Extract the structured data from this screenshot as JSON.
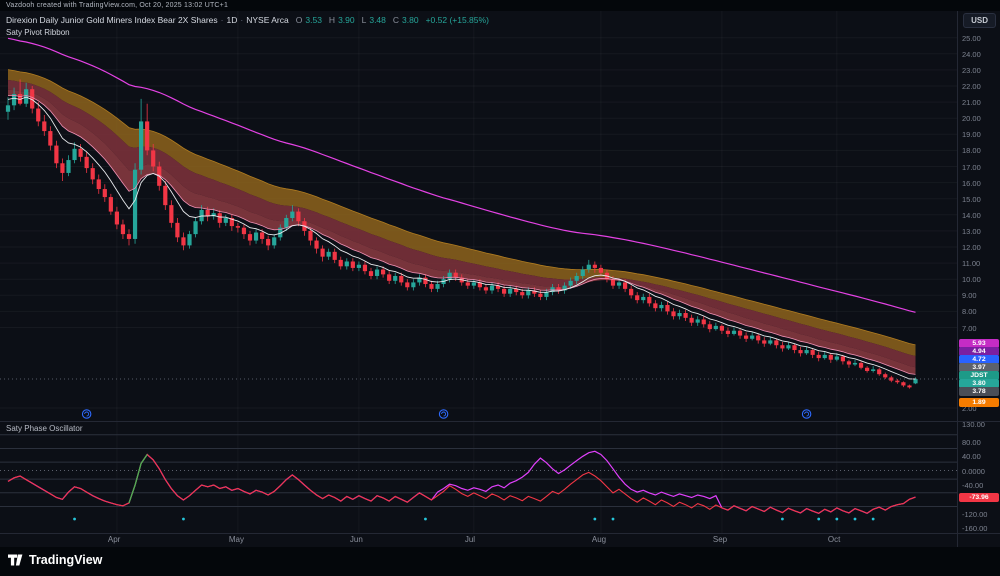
{
  "topbar": {
    "watermark": "Vazdooh created with TradingView.com, Oct 20, 2025 13:02 UTC+1"
  },
  "header": {
    "title": "Direxion Daily Junior Gold Miners Index Bear 2X Shares",
    "separator": "·",
    "timeframe": "1D",
    "exchange": "NYSE Arca",
    "ohlc": {
      "o_label": "O",
      "o": "3.53",
      "h_label": "H",
      "h": "3.90",
      "l_label": "L",
      "l": "3.48",
      "c_label": "C",
      "c": "3.80",
      "change": "+0.52 (+15.85%)"
    },
    "indicator": "Saty Pivot Ribbon"
  },
  "currency_button": {
    "label": "USD"
  },
  "branding": {
    "name": "TradingView"
  },
  "colors": {
    "up": "#26a69a",
    "down": "#f23645",
    "ribbon_fast": "#e8eaed",
    "ribbon_pivot": "#f191b5",
    "ribbon_fill_top": "#8a611c",
    "ribbon_fill_mid": "#77303a",
    "ribbon_fill_low": "#8c3b42",
    "ribbon_edge": "#b07c20",
    "slow_ema": "#e442e4",
    "osc_line": "#f23645",
    "osc_signal": "#e040fb",
    "osc_green": "#4caf50",
    "dots": "#26c6da",
    "marker": "#2e6bff"
  },
  "price_axis": {
    "ticks": [
      {
        "label": "25.00",
        "value": 25
      },
      {
        "label": "24.00",
        "value": 24
      },
      {
        "label": "23.00",
        "value": 23
      },
      {
        "label": "22.00",
        "value": 22
      },
      {
        "label": "21.00",
        "value": 21
      },
      {
        "label": "20.00",
        "value": 20
      },
      {
        "label": "19.00",
        "value": 19
      },
      {
        "label": "18.00",
        "value": 18
      },
      {
        "label": "17.00",
        "value": 17
      },
      {
        "label": "16.00",
        "value": 16
      },
      {
        "label": "15.00",
        "value": 15
      },
      {
        "label": "14.00",
        "value": 14
      },
      {
        "label": "13.00",
        "value": 13
      },
      {
        "label": "12.00",
        "value": 12
      },
      {
        "label": "11.00",
        "value": 11
      },
      {
        "label": "10.00",
        "value": 10
      },
      {
        "label": "9.00",
        "value": 9
      },
      {
        "label": "8.00",
        "value": 8
      },
      {
        "label": "7.00",
        "value": 7
      },
      {
        "label": "2.00",
        "value": 2
      }
    ],
    "chips": [
      {
        "label": "5.93",
        "color": "#c52cc5"
      },
      {
        "label": "4.94",
        "color": "#7b1fa2"
      },
      {
        "label": "4.72",
        "color": "#2962ff"
      },
      {
        "label": "3.97",
        "color": "#5d616b"
      },
      {
        "label": "JDST",
        "color": "#1d9a88"
      },
      {
        "label": "3.80",
        "color": "#26a69a"
      },
      {
        "label": "3.78",
        "color": "#4a4e57"
      },
      {
        "label": "1.89",
        "color": "#f57c00"
      }
    ]
  },
  "chart_data": {
    "type": "candlestick",
    "symbol": "JDST",
    "interval": "1D",
    "title": "Direxion Daily Junior Gold Miners Index Bear 2X Shares",
    "ylim": [
      2,
      26.5
    ],
    "price_line": 3.8,
    "event_marker_indices": [
      13,
      72,
      132
    ],
    "months": [
      {
        "label": "Apr",
        "index": 18
      },
      {
        "label": "May",
        "index": 38
      },
      {
        "label": "Jun",
        "index": 58
      },
      {
        "label": "Jul",
        "index": 77
      },
      {
        "label": "Aug",
        "index": 98
      },
      {
        "label": "Sep",
        "index": 118
      },
      {
        "label": "Oct",
        "index": 137
      }
    ],
    "ribbon": {
      "name": "Saty Pivot Ribbon",
      "ema_periods": [
        8,
        13,
        21,
        34,
        48
      ],
      "slow_ema_period": 90
    },
    "candles": [
      [
        20.4,
        21.3,
        19.9,
        20.8
      ],
      [
        20.8,
        21.9,
        20.5,
        21.5
      ],
      [
        21.5,
        22.4,
        20.8,
        20.9
      ],
      [
        20.9,
        22.2,
        20.7,
        21.8
      ],
      [
        21.8,
        22.0,
        20.3,
        20.6
      ],
      [
        20.6,
        21.0,
        19.5,
        19.8
      ],
      [
        19.8,
        20.2,
        18.9,
        19.2
      ],
      [
        19.2,
        19.5,
        18.0,
        18.3
      ],
      [
        18.3,
        18.6,
        16.9,
        17.2
      ],
      [
        17.2,
        17.5,
        16.1,
        16.6
      ],
      [
        16.6,
        17.7,
        16.4,
        17.4
      ],
      [
        17.4,
        18.5,
        17.2,
        18.1
      ],
      [
        18.1,
        18.4,
        17.3,
        17.6
      ],
      [
        17.6,
        17.9,
        16.6,
        16.9
      ],
      [
        16.9,
        17.2,
        15.9,
        16.2
      ],
      [
        16.2,
        16.5,
        15.3,
        15.6
      ],
      [
        15.6,
        15.9,
        14.8,
        15.1
      ],
      [
        15.1,
        15.3,
        14.0,
        14.2
      ],
      [
        14.2,
        14.5,
        13.1,
        13.4
      ],
      [
        13.4,
        13.7,
        12.5,
        12.8
      ],
      [
        12.8,
        13.1,
        12.1,
        12.5
      ],
      [
        12.5,
        17.2,
        12.2,
        16.8
      ],
      [
        16.8,
        21.2,
        16.5,
        19.8
      ],
      [
        19.8,
        20.9,
        17.7,
        18.0
      ],
      [
        18.0,
        18.4,
        16.7,
        17.0
      ],
      [
        17.0,
        17.3,
        15.5,
        15.8
      ],
      [
        15.8,
        16.1,
        14.3,
        14.6
      ],
      [
        14.6,
        14.9,
        13.2,
        13.5
      ],
      [
        13.5,
        13.8,
        12.3,
        12.6
      ],
      [
        12.6,
        12.9,
        11.8,
        12.1
      ],
      [
        12.1,
        13.0,
        11.9,
        12.8
      ],
      [
        12.8,
        13.8,
        12.6,
        13.6
      ],
      [
        13.6,
        14.6,
        13.4,
        14.3
      ],
      [
        14.3,
        14.5,
        13.6,
        13.9
      ],
      [
        13.9,
        14.4,
        13.7,
        14.1
      ],
      [
        14.1,
        14.3,
        13.2,
        13.5
      ],
      [
        13.5,
        14.0,
        13.3,
        13.8
      ],
      [
        13.8,
        14.0,
        13.0,
        13.3
      ],
      [
        13.3,
        13.5,
        12.9,
        13.2
      ],
      [
        13.2,
        13.4,
        12.5,
        12.8
      ],
      [
        12.8,
        13.0,
        12.1,
        12.4
      ],
      [
        12.4,
        13.1,
        12.2,
        12.9
      ],
      [
        12.9,
        13.1,
        12.2,
        12.5
      ],
      [
        12.5,
        12.7,
        11.8,
        12.1
      ],
      [
        12.1,
        12.8,
        11.9,
        12.6
      ],
      [
        12.6,
        13.4,
        12.4,
        13.2
      ],
      [
        13.2,
        14.0,
        13.0,
        13.8
      ],
      [
        13.8,
        14.6,
        13.6,
        14.2
      ],
      [
        14.2,
        14.4,
        13.3,
        13.6
      ],
      [
        13.6,
        13.8,
        12.7,
        13.0
      ],
      [
        13.0,
        13.2,
        12.1,
        12.4
      ],
      [
        12.4,
        12.6,
        11.6,
        11.9
      ],
      [
        11.9,
        12.1,
        11.1,
        11.4
      ],
      [
        11.4,
        11.9,
        11.2,
        11.7
      ],
      [
        11.7,
        11.9,
        11.0,
        11.2
      ],
      [
        11.2,
        11.4,
        10.6,
        10.8
      ],
      [
        10.8,
        11.3,
        10.6,
        11.1
      ],
      [
        11.1,
        11.3,
        10.5,
        10.7
      ],
      [
        10.7,
        11.1,
        10.5,
        10.9
      ],
      [
        10.9,
        11.1,
        10.3,
        10.5
      ],
      [
        10.5,
        10.7,
        10.0,
        10.2
      ],
      [
        10.2,
        10.8,
        10.0,
        10.6
      ],
      [
        10.6,
        10.8,
        10.1,
        10.3
      ],
      [
        10.3,
        10.5,
        9.7,
        9.9
      ],
      [
        9.9,
        10.4,
        9.7,
        10.2
      ],
      [
        10.2,
        10.4,
        9.6,
        9.8
      ],
      [
        9.8,
        10.0,
        9.3,
        9.5
      ],
      [
        9.5,
        10.0,
        9.3,
        9.8
      ],
      [
        9.8,
        10.3,
        9.6,
        10.1
      ],
      [
        10.1,
        10.3,
        9.5,
        9.7
      ],
      [
        9.7,
        9.9,
        9.2,
        9.4
      ],
      [
        9.4,
        9.9,
        9.2,
        9.7
      ],
      [
        9.7,
        10.2,
        9.5,
        10.0
      ],
      [
        10.0,
        10.6,
        9.8,
        10.4
      ],
      [
        10.4,
        10.6,
        9.9,
        10.1
      ],
      [
        10.1,
        10.3,
        9.6,
        9.8
      ],
      [
        9.8,
        10.0,
        9.4,
        9.6
      ],
      [
        9.6,
        10.0,
        9.4,
        9.8
      ],
      [
        9.8,
        10.0,
        9.3,
        9.5
      ],
      [
        9.5,
        9.7,
        9.1,
        9.3
      ],
      [
        9.3,
        9.8,
        9.1,
        9.6
      ],
      [
        9.6,
        9.8,
        9.2,
        9.4
      ],
      [
        9.4,
        9.6,
        8.9,
        9.1
      ],
      [
        9.1,
        9.6,
        8.9,
        9.4
      ],
      [
        9.4,
        9.6,
        9.0,
        9.2
      ],
      [
        9.2,
        9.4,
        8.8,
        9.0
      ],
      [
        9.0,
        9.5,
        8.8,
        9.3
      ],
      [
        9.3,
        9.5,
        8.9,
        9.1
      ],
      [
        9.1,
        9.3,
        8.7,
        8.9
      ],
      [
        8.9,
        9.4,
        8.7,
        9.2
      ],
      [
        9.2,
        9.7,
        9.0,
        9.5
      ],
      [
        9.5,
        9.7,
        9.1,
        9.3
      ],
      [
        9.3,
        9.8,
        9.1,
        9.6
      ],
      [
        9.6,
        10.1,
        9.4,
        9.9
      ],
      [
        9.9,
        10.4,
        9.7,
        10.2
      ],
      [
        10.2,
        10.8,
        10.0,
        10.6
      ],
      [
        10.6,
        11.2,
        10.4,
        10.9
      ],
      [
        10.9,
        11.1,
        10.4,
        10.7
      ],
      [
        10.7,
        10.9,
        10.2,
        10.4
      ],
      [
        10.4,
        10.6,
        9.8,
        10.0
      ],
      [
        10.0,
        10.2,
        9.4,
        9.6
      ],
      [
        9.6,
        10.0,
        9.4,
        9.8
      ],
      [
        9.8,
        10.0,
        9.2,
        9.4
      ],
      [
        9.4,
        9.6,
        8.8,
        9.0
      ],
      [
        9.0,
        9.2,
        8.5,
        8.7
      ],
      [
        8.7,
        9.1,
        8.5,
        8.9
      ],
      [
        8.9,
        9.1,
        8.3,
        8.5
      ],
      [
        8.5,
        8.7,
        8.0,
        8.2
      ],
      [
        8.2,
        8.6,
        8.0,
        8.4
      ],
      [
        8.4,
        8.6,
        7.8,
        8.0
      ],
      [
        8.0,
        8.2,
        7.5,
        7.7
      ],
      [
        7.7,
        8.1,
        7.5,
        7.9
      ],
      [
        7.9,
        8.1,
        7.4,
        7.6
      ],
      [
        7.6,
        7.8,
        7.1,
        7.3
      ],
      [
        7.3,
        7.7,
        7.1,
        7.5
      ],
      [
        7.5,
        7.7,
        7.0,
        7.2
      ],
      [
        7.2,
        7.4,
        6.7,
        6.9
      ],
      [
        6.9,
        7.3,
        6.8,
        7.1
      ],
      [
        7.1,
        7.2,
        6.6,
        6.8
      ],
      [
        6.8,
        7.0,
        6.4,
        6.6
      ],
      [
        6.6,
        7.0,
        6.5,
        6.8
      ],
      [
        6.8,
        6.9,
        6.3,
        6.5
      ],
      [
        6.5,
        6.7,
        6.1,
        6.3
      ],
      [
        6.3,
        6.7,
        6.2,
        6.5
      ],
      [
        6.5,
        6.6,
        6.0,
        6.2
      ],
      [
        6.2,
        6.4,
        5.8,
        6.0
      ],
      [
        6.0,
        6.4,
        5.9,
        6.2
      ],
      [
        6.2,
        6.3,
        5.7,
        5.9
      ],
      [
        5.9,
        6.1,
        5.5,
        5.7
      ],
      [
        5.7,
        6.1,
        5.6,
        5.9
      ],
      [
        5.9,
        6.0,
        5.4,
        5.6
      ],
      [
        5.6,
        5.8,
        5.2,
        5.4
      ],
      [
        5.4,
        5.8,
        5.3,
        5.6
      ],
      [
        5.6,
        5.7,
        5.1,
        5.3
      ],
      [
        5.3,
        5.5,
        4.9,
        5.1
      ],
      [
        5.1,
        5.5,
        5.0,
        5.3
      ],
      [
        5.3,
        5.4,
        4.8,
        5.0
      ],
      [
        5.0,
        5.4,
        4.9,
        5.2
      ],
      [
        5.2,
        5.3,
        4.7,
        4.9
      ],
      [
        4.9,
        5.0,
        4.5,
        4.7
      ],
      [
        4.7,
        5.0,
        4.6,
        4.8
      ],
      [
        4.8,
        4.9,
        4.4,
        4.5
      ],
      [
        4.5,
        4.6,
        4.2,
        4.3
      ],
      [
        4.3,
        4.6,
        4.2,
        4.4
      ],
      [
        4.4,
        4.5,
        4.0,
        4.1
      ],
      [
        4.1,
        4.2,
        3.8,
        3.9
      ],
      [
        3.9,
        4.0,
        3.6,
        3.7
      ],
      [
        3.7,
        3.8,
        3.5,
        3.6
      ],
      [
        3.6,
        3.65,
        3.3,
        3.4
      ],
      [
        3.4,
        3.45,
        3.2,
        3.28
      ],
      [
        3.53,
        3.9,
        3.48,
        3.8
      ]
    ],
    "oscillator": {
      "name": "Saty Phase Oscillator",
      "ylim": [
        -160,
        130
      ],
      "zones": [
        100,
        61.8,
        23.6,
        0,
        -23.6,
        -61.8,
        -100
      ],
      "last_value": "-73.96",
      "green_segment": [
        20,
        23
      ],
      "dot_value": -135,
      "dots": [
        11,
        29,
        69,
        97,
        100,
        128,
        134,
        137,
        140,
        143
      ],
      "axis_ticks": [
        {
          "label": "130.00",
          "value": 130
        },
        {
          "label": "80.00",
          "value": 80
        },
        {
          "label": "40.00",
          "value": 40
        },
        {
          "label": "0.0000",
          "value": 0
        },
        {
          "label": "-40.00",
          "value": -40
        },
        {
          "label": "-120.00",
          "value": -120
        },
        {
          "label": "-160.00",
          "value": -160
        }
      ],
      "values": [
        -30,
        -20,
        -15,
        -25,
        -35,
        -45,
        -55,
        -65,
        -75,
        -80,
        -60,
        -45,
        -50,
        -60,
        -70,
        -78,
        -85,
        -90,
        -95,
        -98,
        -90,
        -40,
        20,
        45,
        30,
        5,
        -25,
        -50,
        -70,
        -82,
        -70,
        -55,
        -40,
        -45,
        -40,
        -50,
        -45,
        -55,
        -50,
        -58,
        -65,
        -55,
        -60,
        -68,
        -58,
        -42,
        -25,
        -12,
        -25,
        -40,
        -55,
        -68,
        -78,
        -68,
        -75,
        -85,
        -72,
        -80,
        -70,
        -78,
        -85,
        -70,
        -76,
        -85,
        -72,
        -80,
        -88,
        -75,
        -62,
        -72,
        -82,
        -70,
        -58,
        -42,
        -52,
        -64,
        -72,
        -62,
        -70,
        -78,
        -65,
        -72,
        -82,
        -70,
        -76,
        -84,
        -72,
        -78,
        -85,
        -72,
        -58,
        -65,
        -52,
        -38,
        -25,
        -12,
        -5,
        -15,
        -28,
        -45,
        -62,
        -52,
        -65,
        -78,
        -88,
        -76,
        -85,
        -95,
        -82,
        -90,
        -100,
        -88,
        -95,
        -104,
        -92,
        -98,
        -108,
        -96,
        -104,
        -110,
        -98,
        -105,
        -112,
        -100,
        -107,
        -114,
        -102,
        -110,
        -117,
        -105,
        -112,
        -118,
        -106,
        -113,
        -119,
        -108,
        -115,
        -104,
        -112,
        -118,
        -106,
        -112,
        -119,
        -108,
        -102,
        -110,
        -100,
        -95,
        -92,
        -80,
        -73.96
      ],
      "signal": [
        -30,
        -20,
        -15,
        -25,
        -35,
        -45,
        -55,
        -65,
        -75,
        -80,
        -60,
        -45,
        -50,
        -60,
        -70,
        -78,
        -85,
        -90,
        -95,
        -98,
        -90,
        -40,
        20,
        45,
        30,
        5,
        -25,
        -50,
        -70,
        -82,
        -70,
        -55,
        -40,
        -45,
        -40,
        -50,
        -45,
        -55,
        -50,
        -58,
        -65,
        -55,
        -60,
        -68,
        -58,
        -42,
        -25,
        -12,
        -25,
        -40,
        -55,
        -68,
        -78,
        -68,
        -75,
        -85,
        -72,
        -80,
        -70,
        -78,
        -85,
        -70,
        -76,
        -85,
        -72,
        -80,
        -88,
        -75,
        -62,
        -72,
        -82,
        -60,
        -50,
        -38,
        -42,
        -50,
        -55,
        -48,
        -52,
        -58,
        -45,
        -40,
        -48,
        -35,
        -28,
        -18,
        -5,
        18,
        35,
        22,
        5,
        -8,
        2,
        15,
        28,
        40,
        50,
        54,
        45,
        28,
        5,
        -18,
        -38,
        -52,
        -60,
        -55,
        -62,
        -68,
        -60,
        -66,
        -72,
        -65,
        -70,
        -75,
        -68,
        -72,
        -78,
        -70,
        -104,
        -110,
        -98,
        -105,
        -112,
        -100,
        -107,
        -114,
        -102,
        -110,
        -117,
        -105,
        -112,
        -118,
        -106,
        -113,
        -119,
        -108,
        -115,
        -104,
        -112,
        -118,
        -106,
        -112,
        -119,
        -108,
        -102,
        -110,
        -100,
        -95,
        -92,
        -80,
        -73.96
      ]
    }
  }
}
